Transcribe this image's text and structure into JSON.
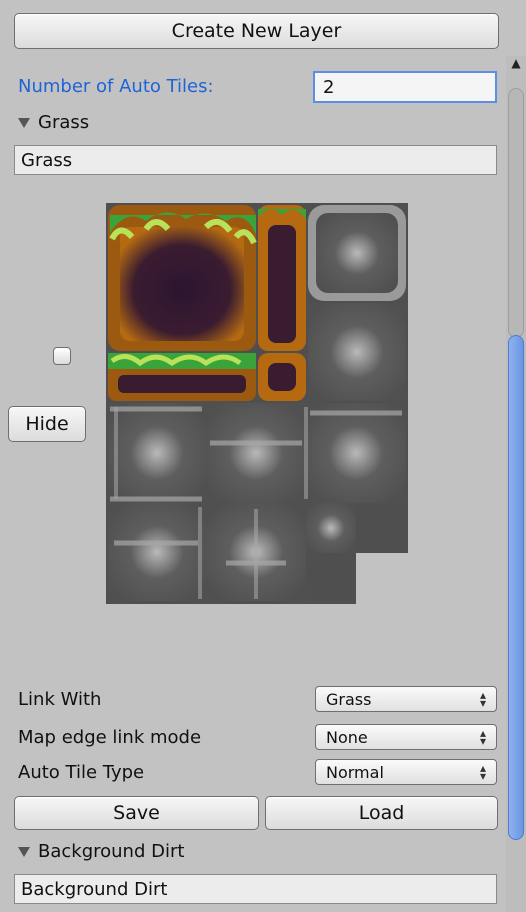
{
  "toolbar": {
    "create_layer_label": "Create New Layer"
  },
  "settings": {
    "auto_tiles_label": "Number of Auto Tiles:",
    "auto_tiles_value": "2"
  },
  "layers": [
    {
      "foldout_label": "Grass",
      "name_value": "Grass",
      "hide_label": "Hide",
      "link_with_label": "Link With",
      "link_with_value": "Grass",
      "edge_mode_label": "Map edge link mode",
      "edge_mode_value": "None",
      "tile_type_label": "Auto Tile Type",
      "tile_type_value": "Normal",
      "save_label": "Save",
      "load_label": "Load"
    },
    {
      "foldout_label": "Background Dirt",
      "name_value": "Background Dirt"
    }
  ],
  "icons": {
    "scroll_up": "up-arrow-icon",
    "popup": "up-down-arrows-icon",
    "foldout": "triangle-down-icon"
  },
  "colors": {
    "accent": "#1e63d8",
    "scroll_thumb": "#7aa3ea"
  }
}
